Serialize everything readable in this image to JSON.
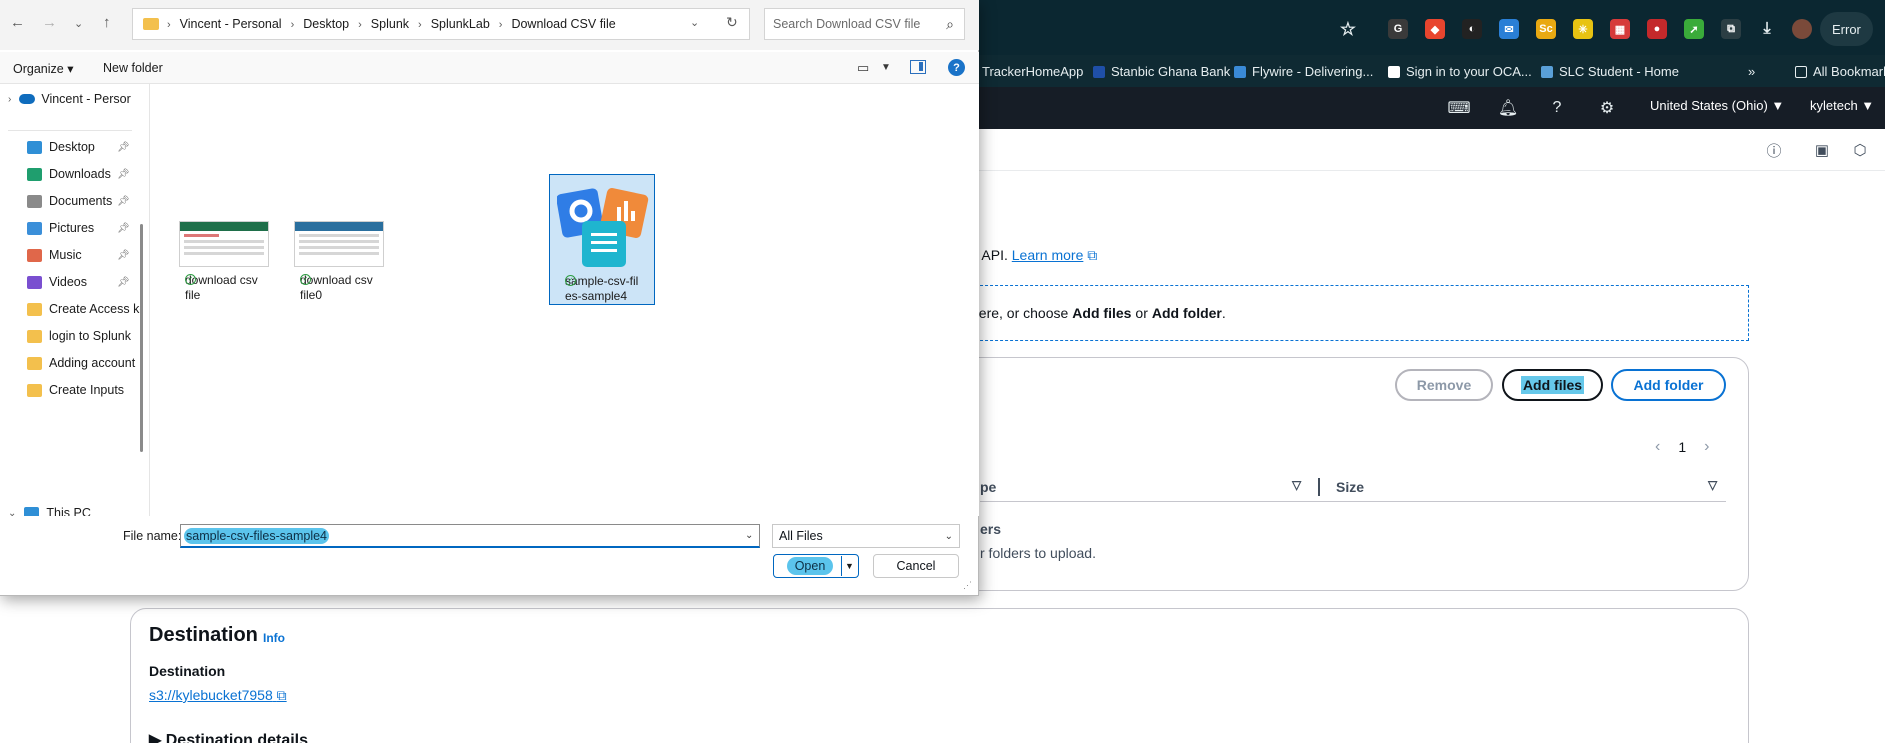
{
  "browser": {
    "error_label": "Error",
    "extensions": [
      {
        "name": "grammarly-icon",
        "glyph": "G",
        "color": "#3a3a3a"
      },
      {
        "name": "extension-red-icon",
        "glyph": "◆",
        "color": "#e8452e"
      },
      {
        "name": "extension-dark-icon",
        "glyph": "◐",
        "color": "#222222"
      },
      {
        "name": "mail-icon",
        "glyph": "✉",
        "color": "#2a7fd6"
      },
      {
        "name": "sc-extension-icon",
        "glyph": "Sc",
        "color": "#e9a912"
      },
      {
        "name": "extension-yellow-icon",
        "glyph": "✳",
        "color": "#e8c312"
      },
      {
        "name": "extension-grid-icon",
        "glyph": "▦",
        "color": "#d63a3a"
      },
      {
        "name": "extension-red-badge-icon",
        "glyph": "●",
        "color": "#c4292b"
      },
      {
        "name": "extension-green-icon",
        "glyph": "➚",
        "color": "#3aab3a"
      },
      {
        "name": "puzzle-icon",
        "glyph": "⧉",
        "color": "#2b3e44"
      }
    ],
    "bookmarks": [
      {
        "label": "TrackerHomeApp",
        "color": ""
      },
      {
        "label": "Stanbic Ghana Bank",
        "color": "#1f4fa8"
      },
      {
        "label": "Flywire - Delivering...",
        "color": "#3a8ad6"
      },
      {
        "label": "Sign in to your OCA...",
        "color": "#ffffff"
      },
      {
        "label": "SLC Student - Home",
        "color": "#5aa0d8"
      }
    ],
    "bookmarks_more": "»",
    "all_bookmarks": "All Bookmarks"
  },
  "aws": {
    "region": "United States (Ohio) ▼",
    "account": "kyletech ▼",
    "api_text_prefix": "T API.",
    "learn_more": "Learn more",
    "dropzone_prefix": "here, or choose",
    "dropzone_add_files": "Add files",
    "dropzone_or": "or",
    "dropzone_add_folder": "Add folder",
    "dropzone_suffix": ".",
    "remove_label": "Remove",
    "add_files_label": "Add files",
    "add_folder_label": "Add folder",
    "page_number": "1",
    "col_type": "pe",
    "col_size": "Size",
    "empty_title": "ers",
    "empty_sub": "r folders to upload.",
    "destination_title": "Destination",
    "destination_info": "Info",
    "destination_label": "Destination",
    "destination_link": "s3://kylebucket7958",
    "destination_details": "▶ Destination details"
  },
  "dialog": {
    "breadcrumbs": [
      "Vincent - Personal",
      "Desktop",
      "Splunk",
      "SplunkLab",
      "Download CSV file"
    ],
    "search_placeholder": "Search Download CSV file",
    "organize_label": "Organize ▾",
    "new_folder_label": "New folder",
    "nav": {
      "onedrive": "Vincent - Persor",
      "items": [
        {
          "label": "Desktop",
          "icon": "desktop-icon",
          "color": "#2f8fd6",
          "pinned": true
        },
        {
          "label": "Downloads",
          "icon": "downloads-icon",
          "color": "#1f9e6e",
          "pinned": true
        },
        {
          "label": "Documents",
          "icon": "documents-icon",
          "color": "#8a8a8a",
          "pinned": true
        },
        {
          "label": "Pictures",
          "icon": "pictures-icon",
          "color": "#3b8fd9",
          "pinned": true
        },
        {
          "label": "Music",
          "icon": "music-icon",
          "color": "#e0674a",
          "pinned": true
        },
        {
          "label": "Videos",
          "icon": "videos-icon",
          "color": "#7a4fd0",
          "pinned": true
        },
        {
          "label": "Create Access ke",
          "icon": "folder-icon",
          "color": "#f3c04d",
          "pinned": false
        },
        {
          "label": "login to Splunk",
          "icon": "folder-icon",
          "color": "#f3c04d",
          "pinned": false
        },
        {
          "label": "Adding account",
          "icon": "folder-icon",
          "color": "#f3c04d",
          "pinned": false
        },
        {
          "label": "Create Inputs",
          "icon": "folder-icon",
          "color": "#f3c04d",
          "pinned": false
        }
      ],
      "this_pc": "This PC"
    },
    "files": [
      {
        "line1": "download csv",
        "line2": "file"
      },
      {
        "line1": "download csv",
        "line2": "file0"
      },
      {
        "line1": "sample-csv-fil",
        "line2": "es-sample4"
      }
    ],
    "filename_label": "File name:",
    "filename_value": "sample-csv-files-sample4",
    "filetype_value": "All Files",
    "open_label": "Open",
    "cancel_label": "Cancel"
  }
}
